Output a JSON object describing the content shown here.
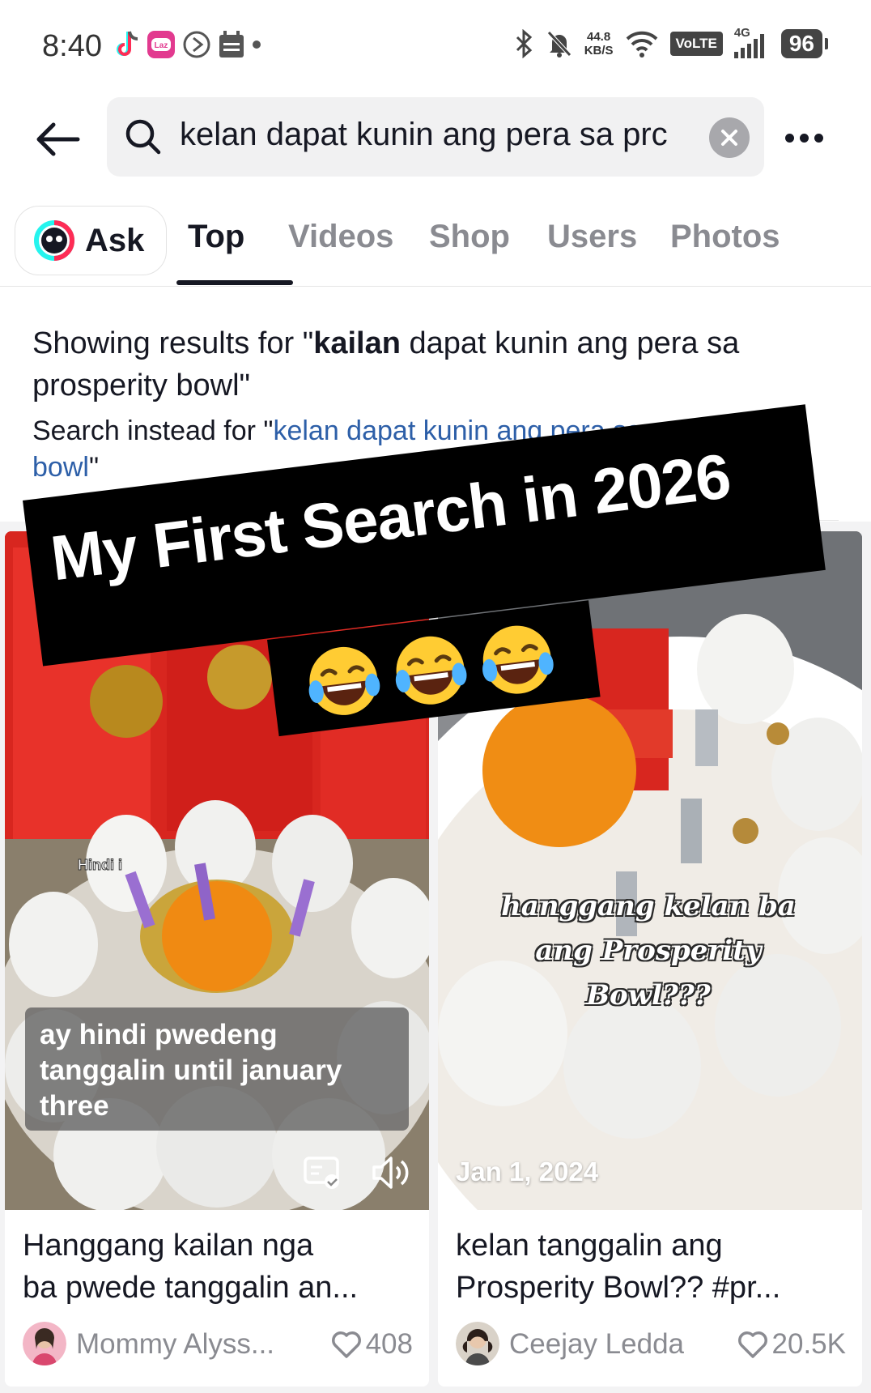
{
  "status_bar": {
    "time": "8:40",
    "net_speed_value": "44.8",
    "net_speed_unit": "KB/S",
    "volte": "VoLTE",
    "network": "4G",
    "battery": "96"
  },
  "search": {
    "query": "kelan dapat kunin ang pera sa prc"
  },
  "tabs": {
    "ask": "Ask",
    "top": "Top",
    "videos": "Videos",
    "shop": "Shop",
    "users": "Users",
    "photos": "Photos",
    "active": "Top"
  },
  "correction": {
    "prefix": "Showing results for \"",
    "bold_word": "kailan",
    "rest": " dapat kunin ang pera sa prosperity bowl\"",
    "instead_prefix": "Search instead for \"",
    "instead_link": "kelan dapat kunin ang pera sa prosperity bowl",
    "instead_suffix": "\""
  },
  "meme_overlay": {
    "text": "My First Search in 2026",
    "emoji": "😂😂😂"
  },
  "results": [
    {
      "overlay_tag": "Hindi i",
      "caption_overlay": "ay hindi pwedeng tanggalin until january three",
      "title_line1": "Hanggang kailan nga",
      "title_line2": "ba pwede tanggalin an...",
      "author": "Mommy Alyss...",
      "likes": "408"
    },
    {
      "overlay_text": "hanggang kelan ba ang Prosperity Bowl???",
      "date": "Jan 1, 2024",
      "title_line1": "kelan tanggalin ang",
      "title_line2": "Prosperity Bowl?? #pr...",
      "author": "Ceejay Ledda",
      "likes": "20.5K"
    }
  ]
}
